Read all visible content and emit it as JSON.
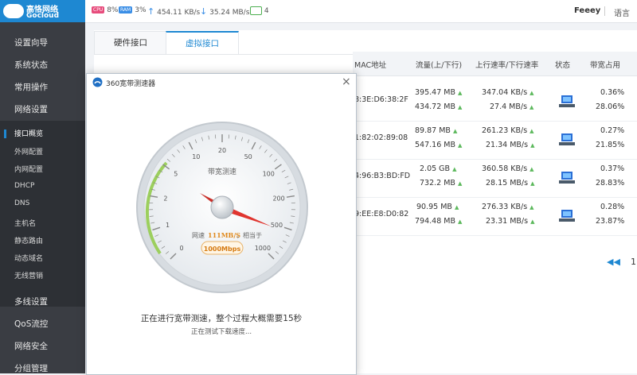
{
  "brand": {
    "name": "高恪网络",
    "sub": "Gocloud"
  },
  "topbar": {
    "cpu_label": "CPU",
    "cpu": "8%",
    "ram_label": "RAM",
    "ram": "3%",
    "upload": "454.11 KB/s",
    "download": "35.24 MB/s",
    "online": "4",
    "user": "Feeey",
    "lang": "语言"
  },
  "sidebar": {
    "items": [
      "设置向导",
      "系统状态",
      "常用操作",
      "网络设置"
    ],
    "subitems": [
      "接口概览",
      "外网配置",
      "内网配置",
      "DHCP",
      "DNS",
      "主机名",
      "静态路由",
      "动态域名",
      "无线营销"
    ],
    "bottom": [
      "多线设置",
      "QoS流控",
      "网络安全",
      "分组管理"
    ]
  },
  "tabs": [
    "硬件接口",
    "虚拟接口"
  ],
  "table": {
    "headers": [
      "MAC地址",
      "流量(上/下行)",
      "上行速率/下行速率",
      "状态",
      "带宽占用"
    ],
    "rows": [
      {
        "mac": "8:3E:D6:38:2F",
        "up": "395.47 MB",
        "down": "434.72 MB",
        "ur": "347.04 KB/s",
        "dr": "27.4 MB/s",
        "bu": "0.36%",
        "bd": "28.06%"
      },
      {
        "mac": "1:82:02:89:08",
        "up": "89.87 MB",
        "down": "547.16 MB",
        "ur": "261.23 KB/s",
        "dr": "21.34 MB/s",
        "bu": "0.27%",
        "bd": "21.85%"
      },
      {
        "mac": "4:96:B3:BD:FD",
        "up": "2.05 GB",
        "down": "732.2 MB",
        "ur": "360.58 KB/s",
        "dr": "28.15 MB/s",
        "bu": "0.37%",
        "bd": "28.83%"
      },
      {
        "mac": "9:EE:E8:D0:82",
        "up": "90.95 MB",
        "down": "794.48 MB",
        "ur": "276.33 KB/s",
        "dr": "23.31 MB/s",
        "bu": "0.28%",
        "bd": "23.87%"
      }
    ]
  },
  "pager": {
    "page": "1"
  },
  "dialog": {
    "title": "360宽带测速器",
    "gauge_title": "带宽测速",
    "ticks": [
      "0",
      "1",
      "2",
      "5",
      "10",
      "20",
      "50",
      "100",
      "200",
      "500",
      "1000"
    ],
    "speed_label": "网速",
    "speed_value": "111MB/S",
    "equiv": "，相当于",
    "mbps": "1000Mbps",
    "msg": "正在进行宽带测速，整个过程大概需要15秒",
    "sub": "正在测试下载速度..."
  }
}
